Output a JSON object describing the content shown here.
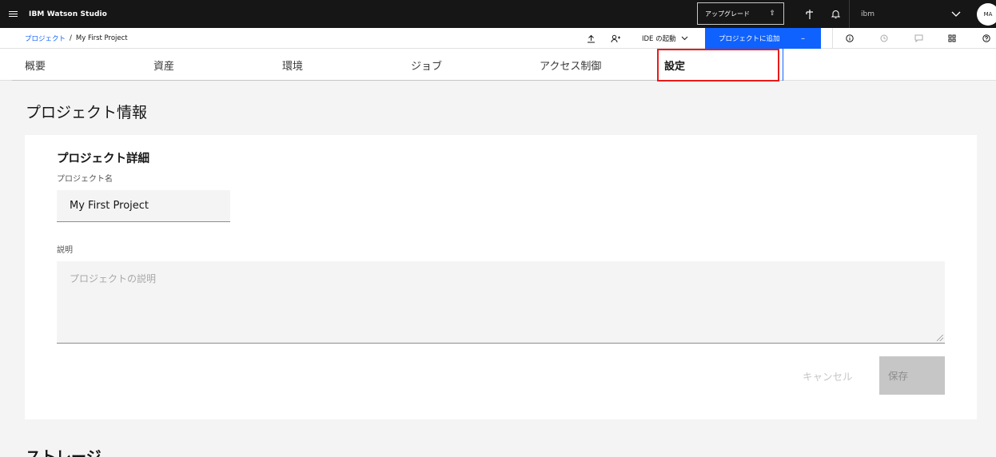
{
  "header": {
    "brand": "IBM Watson Studio",
    "upgrade_label": "アップグレード",
    "account": "ibm",
    "avatar_initials": "MA"
  },
  "subheader": {
    "breadcrumb_root": "プロジェクト",
    "breadcrumb_sep": "/",
    "breadcrumb_current": "My First Project",
    "ide_label": "IDE の起動",
    "add_to_project": "プロジェクトに追加"
  },
  "tabs": [
    {
      "label": "概要"
    },
    {
      "label": "資産"
    },
    {
      "label": "環境"
    },
    {
      "label": "ジョブ"
    },
    {
      "label": "アクセス制御"
    },
    {
      "label": "設定",
      "active": true
    }
  ],
  "page": {
    "section_title": "プロジェクト情報",
    "card_title": "プロジェクト詳細",
    "name_label": "プロジェクト名",
    "name_value": "My First Project",
    "desc_label": "説明",
    "desc_placeholder": "プロジェクトの説明",
    "cancel_label": "キャンセル",
    "save_label": "保存",
    "storage_title": "ストレージ"
  },
  "colors": {
    "primary": "#0f62fe",
    "header_bg": "#161616",
    "highlight": "#e81b1b"
  }
}
